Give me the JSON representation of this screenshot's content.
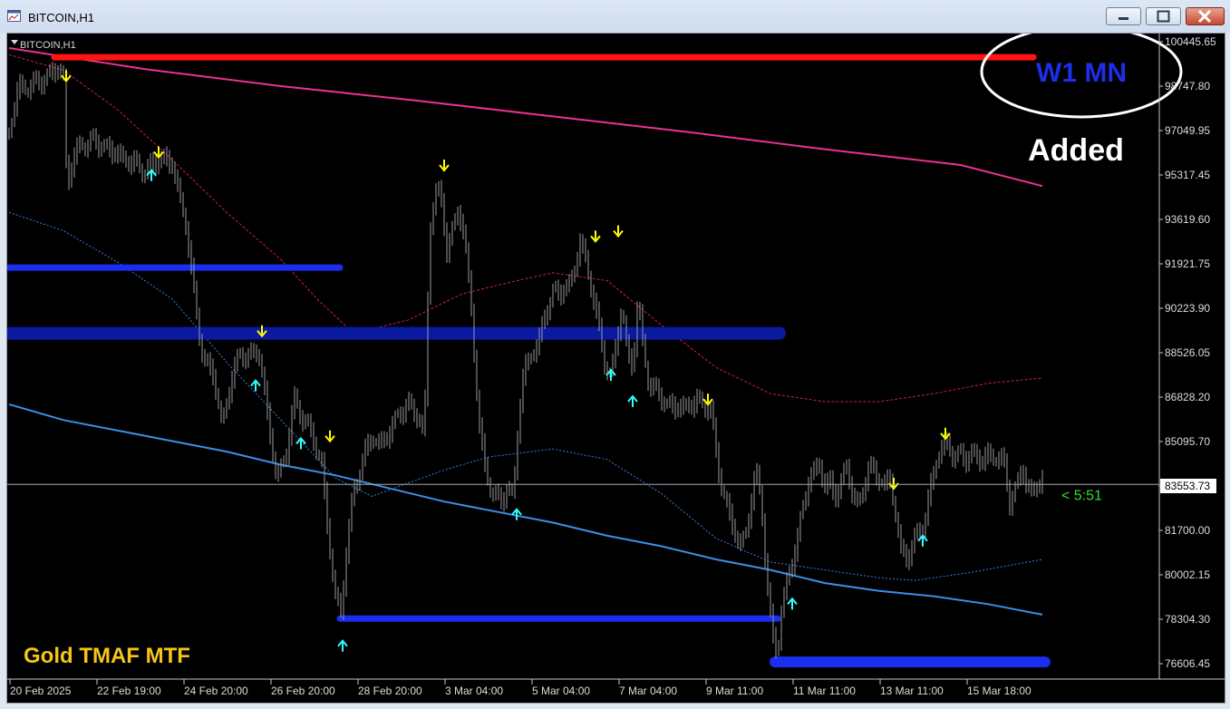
{
  "window": {
    "title": "BITCOIN,H1",
    "chart_label": "BITCOIN,H1",
    "minimize_icon": "minimize-icon",
    "maximize_icon": "maximize-icon",
    "close_icon": "close-icon"
  },
  "annotations": {
    "tf_label": "W1 MN",
    "added_label": "Added",
    "indicator_name": "Gold TMAF MTF",
    "countdown": "< 5:51"
  },
  "colors": {
    "background": "#000000",
    "candles": "#9a9a9a",
    "tf_label": "#1c2fe8",
    "indicator_name": "#f5c518",
    "countdown": "#33dd33",
    "sell_arrow": "#ffff00",
    "buy_arrow": "#33ffff"
  },
  "chart_data": {
    "type": "line",
    "title": "BITCOIN,H1",
    "y_ticks": [
      "100445.65",
      "98747.80",
      "97049.95",
      "95317.45",
      "93619.60",
      "91921.75",
      "90223.90",
      "88526.05",
      "86828.20",
      "85095.70",
      "83553.73",
      "81700.00",
      "80002.15",
      "78304.30",
      "76606.45"
    ],
    "x_ticks": [
      "20 Feb 2025",
      "22 Feb 19:00",
      "24 Feb 20:00",
      "26 Feb 20:00",
      "28 Feb 20:00",
      "3 Mar 04:00",
      "5 Mar 04:00",
      "7 Mar 04:00",
      "9 Mar 11:00",
      "11 Mar 11:00",
      "13 Mar 11:00",
      "15 Mar 18:00"
    ],
    "ylim": [
      76150,
      100700
    ],
    "current_price": 83553.73,
    "price_path": [
      [
        0,
        97000
      ],
      [
        10,
        98600
      ],
      [
        20,
        98700
      ],
      [
        30,
        98800
      ],
      [
        40,
        99000
      ],
      [
        52,
        99400
      ],
      [
        60,
        99000
      ],
      [
        64,
        94800
      ],
      [
        70,
        95900
      ],
      [
        80,
        96500
      ],
      [
        95,
        96600
      ],
      [
        110,
        96300
      ],
      [
        130,
        95900
      ],
      [
        150,
        95500
      ],
      [
        170,
        96000
      ],
      [
        180,
        95700
      ],
      [
        195,
        93500
      ],
      [
        205,
        90500
      ],
      [
        215,
        88200
      ],
      [
        225,
        87800
      ],
      [
        235,
        85800
      ],
      [
        245,
        87500
      ],
      [
        255,
        88600
      ],
      [
        265,
        88300
      ],
      [
        275,
        88800
      ],
      [
        285,
        86200
      ],
      [
        295,
        83800
      ],
      [
        305,
        84600
      ],
      [
        315,
        86800
      ],
      [
        325,
        86000
      ],
      [
        335,
        85400
      ],
      [
        345,
        84300
      ],
      [
        352,
        81600
      ],
      [
        360,
        79400
      ],
      [
        366,
        78600
      ],
      [
        372,
        81000
      ],
      [
        380,
        83300
      ],
      [
        392,
        84700
      ],
      [
        402,
        85400
      ],
      [
        412,
        85000
      ],
      [
        422,
        85800
      ],
      [
        432,
        86300
      ],
      [
        442,
        86600
      ],
      [
        452,
        86100
      ],
      [
        458,
        85300
      ],
      [
        464,
        93200
      ],
      [
        470,
        94800
      ],
      [
        476,
        94500
      ],
      [
        483,
        92500
      ],
      [
        490,
        93300
      ],
      [
        496,
        94100
      ],
      [
        502,
        93000
      ],
      [
        510,
        90300
      ],
      [
        518,
        85900
      ],
      [
        526,
        84000
      ],
      [
        534,
        83200
      ],
      [
        542,
        82900
      ],
      [
        550,
        83400
      ],
      [
        556,
        83100
      ],
      [
        562,
        86000
      ],
      [
        568,
        87800
      ],
      [
        576,
        88600
      ],
      [
        584,
        88800
      ],
      [
        592,
        90200
      ],
      [
        600,
        90800
      ],
      [
        608,
        90900
      ],
      [
        616,
        91000
      ],
      [
        624,
        91800
      ],
      [
        630,
        92700
      ],
      [
        636,
        92200
      ],
      [
        642,
        91100
      ],
      [
        650,
        89600
      ],
      [
        658,
        88100
      ],
      [
        664,
        87600
      ],
      [
        670,
        89000
      ],
      [
        676,
        90300
      ],
      [
        682,
        88600
      ],
      [
        688,
        88000
      ],
      [
        694,
        90600
      ],
      [
        700,
        88600
      ],
      [
        706,
        87400
      ],
      [
        712,
        87100
      ],
      [
        720,
        86900
      ],
      [
        728,
        86500
      ],
      [
        736,
        86500
      ],
      [
        744,
        86500
      ],
      [
        752,
        86600
      ],
      [
        760,
        86700
      ],
      [
        768,
        86600
      ],
      [
        774,
        86300
      ],
      [
        782,
        84300
      ],
      [
        788,
        83200
      ],
      [
        794,
        82500
      ],
      [
        800,
        81800
      ],
      [
        806,
        81200
      ],
      [
        812,
        81600
      ],
      [
        818,
        82800
      ],
      [
        824,
        84000
      ],
      [
        830,
        83000
      ],
      [
        836,
        79800
      ],
      [
        842,
        77800
      ],
      [
        848,
        77200
      ],
      [
        852,
        78800
      ],
      [
        858,
        79800
      ],
      [
        864,
        80600
      ],
      [
        870,
        81500
      ],
      [
        876,
        82800
      ],
      [
        882,
        83700
      ],
      [
        888,
        83900
      ],
      [
        894,
        84500
      ],
      [
        900,
        83400
      ],
      [
        906,
        83600
      ],
      [
        912,
        83100
      ],
      [
        918,
        83700
      ],
      [
        924,
        84200
      ],
      [
        930,
        83300
      ],
      [
        936,
        82700
      ],
      [
        942,
        83400
      ],
      [
        948,
        84100
      ],
      [
        954,
        84100
      ],
      [
        960,
        83800
      ],
      [
        966,
        83500
      ],
      [
        972,
        83700
      ],
      [
        978,
        82500
      ],
      [
        984,
        81000
      ],
      [
        990,
        80800
      ],
      [
        996,
        81100
      ],
      [
        1002,
        81800
      ],
      [
        1010,
        82000
      ],
      [
        1018,
        83700
      ],
      [
        1024,
        84700
      ],
      [
        1030,
        84900
      ],
      [
        1036,
        85100
      ],
      [
        1042,
        84600
      ],
      [
        1050,
        84700
      ],
      [
        1058,
        84500
      ],
      [
        1066,
        84800
      ],
      [
        1074,
        84400
      ],
      [
        1082,
        84700
      ],
      [
        1090,
        84600
      ],
      [
        1098,
        84300
      ],
      [
        1104,
        82900
      ],
      [
        1112,
        83500
      ],
      [
        1118,
        84300
      ],
      [
        1124,
        83200
      ],
      [
        1130,
        83400
      ],
      [
        1136,
        83600
      ],
      [
        1140,
        83700
      ]
    ],
    "series": [
      {
        "points": [
          [
            0,
            100150
          ],
          [
            150,
            99350
          ],
          [
            300,
            98700
          ],
          [
            450,
            98150
          ],
          [
            600,
            97550
          ],
          [
            750,
            96950
          ],
          [
            900,
            96300
          ],
          [
            1050,
            95700
          ],
          [
            1140,
            94900
          ]
        ]
      },
      {
        "points": [
          [
            0,
            99900
          ],
          [
            60,
            99300
          ],
          [
            120,
            97800
          ],
          [
            180,
            95900
          ],
          [
            240,
            93900
          ],
          [
            300,
            92100
          ],
          [
            340,
            90600
          ],
          [
            380,
            89300
          ],
          [
            440,
            89800
          ],
          [
            500,
            90800
          ],
          [
            560,
            91300
          ],
          [
            600,
            91600
          ],
          [
            660,
            91300
          ],
          [
            720,
            89600
          ],
          [
            780,
            88000
          ],
          [
            840,
            87000
          ],
          [
            900,
            86700
          ],
          [
            960,
            86700
          ],
          [
            1020,
            87000
          ],
          [
            1080,
            87400
          ],
          [
            1140,
            87600
          ]
        ]
      },
      {
        "points": [
          [
            0,
            93900
          ],
          [
            60,
            93200
          ],
          [
            120,
            92000
          ],
          [
            180,
            90600
          ],
          [
            240,
            88200
          ],
          [
            300,
            86000
          ],
          [
            360,
            83800
          ],
          [
            400,
            83100
          ],
          [
            480,
            84100
          ],
          [
            530,
            84600
          ],
          [
            600,
            84900
          ],
          [
            660,
            84500
          ],
          [
            720,
            83200
          ],
          [
            780,
            81500
          ],
          [
            840,
            80600
          ],
          [
            900,
            80300
          ],
          [
            960,
            80000
          ],
          [
            1000,
            79900
          ],
          [
            1060,
            80200
          ],
          [
            1140,
            80700
          ]
        ]
      },
      {
        "points": [
          [
            0,
            86600
          ],
          [
            60,
            86000
          ],
          [
            120,
            85600
          ],
          [
            180,
            85200
          ],
          [
            240,
            84800
          ],
          [
            300,
            84300
          ],
          [
            360,
            83900
          ],
          [
            420,
            83400
          ],
          [
            480,
            82900
          ],
          [
            540,
            82500
          ],
          [
            600,
            82100
          ],
          [
            660,
            81600
          ],
          [
            720,
            81200
          ],
          [
            780,
            80700
          ],
          [
            840,
            80300
          ],
          [
            900,
            79800
          ],
          [
            960,
            79500
          ],
          [
            1020,
            79300
          ],
          [
            1080,
            79000
          ],
          [
            1140,
            78600
          ]
        ]
      }
    ],
    "levels": [
      {
        "price": 99800,
        "x_from": 50,
        "x_to": 1130
      },
      {
        "price": 91800,
        "x_from": 0,
        "x_to": 365
      },
      {
        "price": 89300,
        "x_from": 0,
        "x_to": 850
      },
      {
        "price": 78450,
        "x_from": 365,
        "x_to": 848
      },
      {
        "price": 76800,
        "x_from": 845,
        "x_to": 1143
      }
    ],
    "arrows": [
      {
        "type": "sell",
        "x": 63,
        "price": 99100
      },
      {
        "type": "sell",
        "x": 165,
        "price": 96200
      },
      {
        "type": "buy",
        "x": 157,
        "price": 95300
      },
      {
        "type": "sell",
        "x": 480,
        "price": 95700
      },
      {
        "type": "sell",
        "x": 647,
        "price": 93000
      },
      {
        "type": "sell",
        "x": 672,
        "price": 93200
      },
      {
        "type": "sell",
        "x": 279,
        "price": 89400
      },
      {
        "type": "buy",
        "x": 272,
        "price": 87300
      },
      {
        "type": "buy",
        "x": 664,
        "price": 87700
      },
      {
        "type": "buy",
        "x": 688,
        "price": 86700
      },
      {
        "type": "sell",
        "x": 771,
        "price": 86800
      },
      {
        "type": "buy",
        "x": 322,
        "price": 85100
      },
      {
        "type": "sell",
        "x": 354,
        "price": 85400
      },
      {
        "type": "buy",
        "x": 560,
        "price": 82400
      },
      {
        "type": "sell",
        "x": 976,
        "price": 83600
      },
      {
        "type": "sell",
        "x": 1033,
        "price": 85500
      },
      {
        "type": "buy",
        "x": 1008,
        "price": 81400
      },
      {
        "type": "buy",
        "x": 864,
        "price": 79000
      },
      {
        "type": "buy",
        "x": 368,
        "price": 77400
      }
    ]
  }
}
